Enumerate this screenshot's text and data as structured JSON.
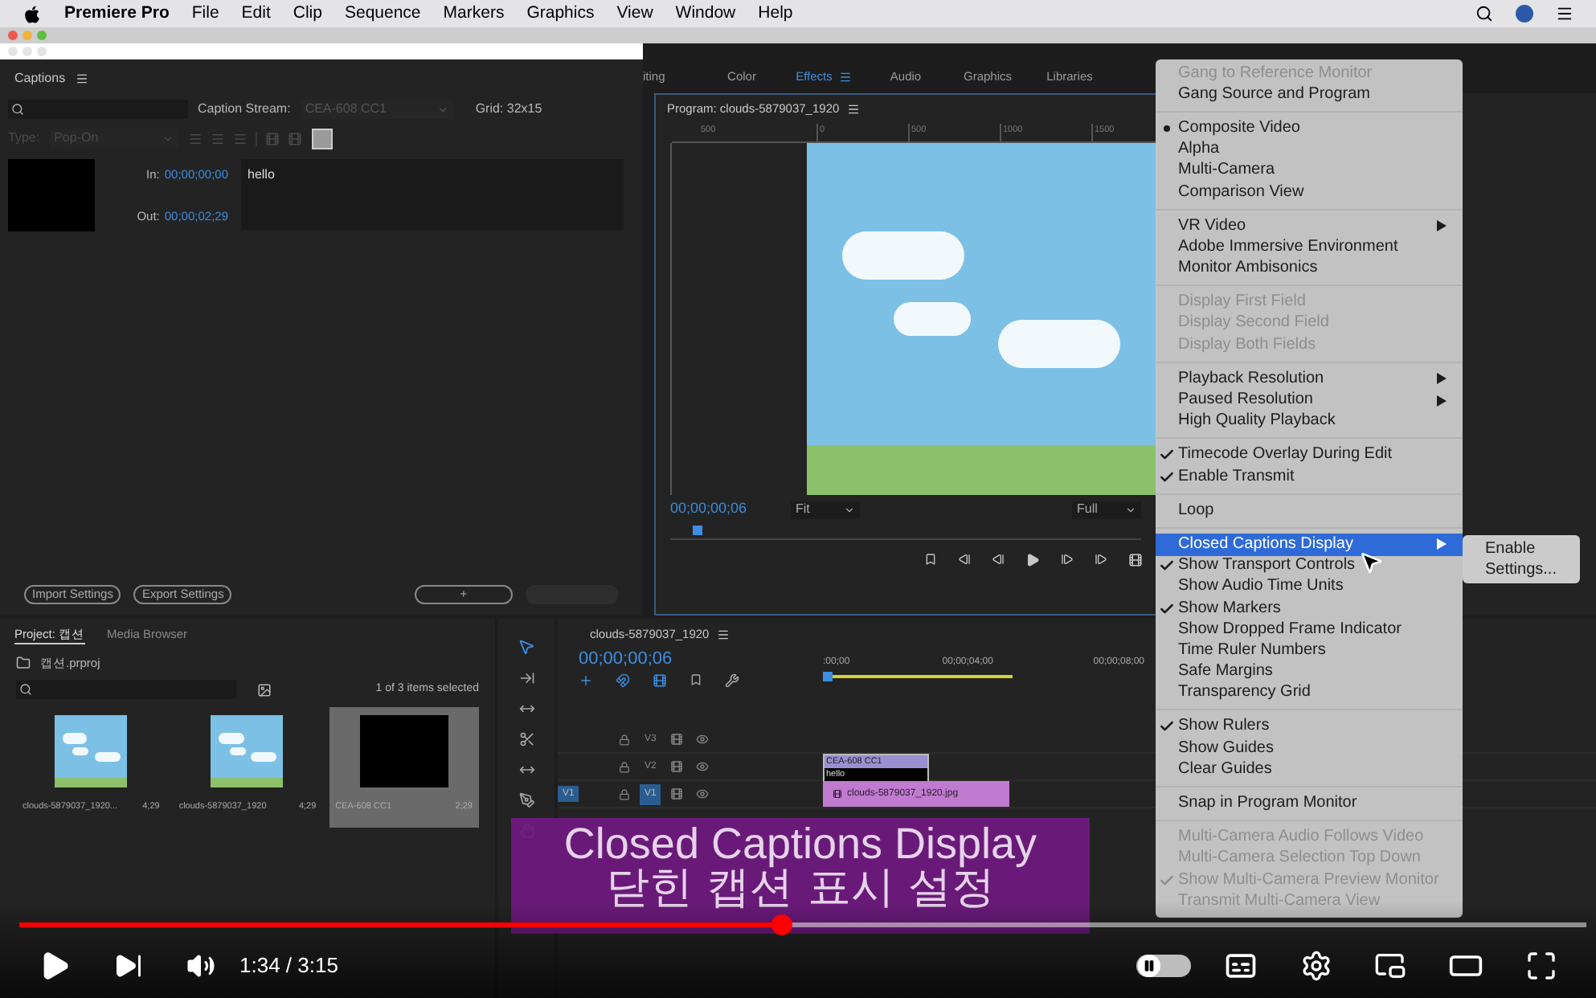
{
  "menubar": {
    "app_name": "Premiere Pro",
    "menus": [
      "File",
      "Edit",
      "Clip",
      "Sequence",
      "Markers",
      "Graphics",
      "View",
      "Window",
      "Help"
    ]
  },
  "workspace_tabs": [
    {
      "label": "iting",
      "selected": false
    },
    {
      "label": "Color",
      "selected": false
    },
    {
      "label": "Effects",
      "selected": true
    },
    {
      "label": "Audio",
      "selected": false
    },
    {
      "label": "Graphics",
      "selected": false
    },
    {
      "label": "Libraries",
      "selected": false
    }
  ],
  "captions_panel": {
    "title": "Captions",
    "caption_stream_label": "Caption Stream:",
    "caption_stream_value": "CEA-608 CC1",
    "grid": "Grid: 32x15",
    "type_label": "Type:",
    "type_value": "Pop-On",
    "in_label": "In:",
    "in_time": "00;00;00;00",
    "out_label": "Out:",
    "out_time": "00;00;02;29",
    "caption_text": "hello",
    "buttons": [
      "Import Settings",
      "Export Settings"
    ],
    "add_button": "+"
  },
  "program_monitor": {
    "title": "Program: clouds-5879037_1920",
    "ruler_labels": [
      "500",
      "0",
      "500",
      "1000",
      "1500"
    ],
    "timecode": "00;00;00;06",
    "zoom": "Fit",
    "resolution": "Full"
  },
  "project_panel": {
    "tabs": [
      {
        "label": "Project: 캡션",
        "selected": true
      },
      {
        "label": "Media Browser",
        "selected": false
      }
    ],
    "project_file": "캡션.prproj",
    "selection_info": "1 of 3 items selected",
    "items": [
      {
        "name": "clouds-5879037_1920...",
        "duration": "4;29",
        "kind": "image",
        "selected": false
      },
      {
        "name": "clouds-5879037_1920",
        "duration": "4;29",
        "kind": "image",
        "selected": false
      },
      {
        "name": "CEA-608 CC1",
        "duration": "2;29",
        "kind": "caption",
        "selected": true
      }
    ]
  },
  "timeline": {
    "title": "clouds-5879037_1920",
    "timecode": "00;00;00;06",
    "ruler_labels": [
      ":00;00",
      "00;00;04;00",
      "00;00;08;00"
    ],
    "source_patch": "V1",
    "tracks": [
      {
        "name": "V3",
        "targeted": false
      },
      {
        "name": "V2",
        "targeted": false
      },
      {
        "name": "V1",
        "targeted": true
      }
    ],
    "caption_clip": {
      "title": "CEA-608 CC1",
      "text": "hello"
    },
    "video_clip": "clouds-5879037_1920.jpg"
  },
  "context_menu": {
    "groups": [
      [
        {
          "label": "Gang to Reference Monitor",
          "kind": "command",
          "checked": false,
          "disabled": true,
          "submenu": false,
          "selected": false
        },
        {
          "label": "Gang Source and Program",
          "kind": "command",
          "checked": false,
          "disabled": false,
          "submenu": false,
          "selected": false
        }
      ],
      [
        {
          "label": "Composite Video",
          "kind": "radio",
          "checked": true,
          "disabled": false,
          "submenu": false,
          "selected": false
        },
        {
          "label": "Alpha",
          "kind": "radio",
          "checked": false,
          "disabled": false,
          "submenu": false,
          "selected": false
        },
        {
          "label": "Multi-Camera",
          "kind": "radio",
          "checked": false,
          "disabled": false,
          "submenu": false,
          "selected": false
        },
        {
          "label": "Comparison View",
          "kind": "radio",
          "checked": false,
          "disabled": false,
          "submenu": false,
          "selected": false
        }
      ],
      [
        {
          "label": "VR Video",
          "kind": "command",
          "checked": false,
          "disabled": false,
          "submenu": true,
          "selected": false
        },
        {
          "label": "Adobe Immersive Environment",
          "kind": "command",
          "checked": false,
          "disabled": false,
          "submenu": false,
          "selected": false
        },
        {
          "label": "Monitor Ambisonics",
          "kind": "command",
          "checked": false,
          "disabled": false,
          "submenu": false,
          "selected": false
        }
      ],
      [
        {
          "label": "Display First Field",
          "kind": "command",
          "checked": false,
          "disabled": true,
          "submenu": false,
          "selected": false
        },
        {
          "label": "Display Second Field",
          "kind": "command",
          "checked": false,
          "disabled": true,
          "submenu": false,
          "selected": false
        },
        {
          "label": "Display Both Fields",
          "kind": "command",
          "checked": false,
          "disabled": true,
          "submenu": false,
          "selected": false
        }
      ],
      [
        {
          "label": "Playback Resolution",
          "kind": "command",
          "checked": false,
          "disabled": false,
          "submenu": true,
          "selected": false
        },
        {
          "label": "Paused Resolution",
          "kind": "command",
          "checked": false,
          "disabled": false,
          "submenu": true,
          "selected": false
        },
        {
          "label": "High Quality Playback",
          "kind": "command",
          "checked": false,
          "disabled": false,
          "submenu": false,
          "selected": false
        }
      ],
      [
        {
          "label": "Timecode Overlay During Edit",
          "kind": "command",
          "checked": true,
          "disabled": false,
          "submenu": false,
          "selected": false
        },
        {
          "label": "Enable Transmit",
          "kind": "command",
          "checked": true,
          "disabled": false,
          "submenu": false,
          "selected": false
        }
      ],
      [
        {
          "label": "Loop",
          "kind": "command",
          "checked": false,
          "disabled": false,
          "submenu": false,
          "selected": false
        }
      ],
      [
        {
          "label": "Closed Captions Display",
          "kind": "command",
          "checked": false,
          "disabled": false,
          "submenu": true,
          "selected": true
        },
        {
          "label": "Show Transport Controls",
          "kind": "command",
          "checked": true,
          "disabled": false,
          "submenu": false,
          "selected": false
        },
        {
          "label": "Show Audio Time Units",
          "kind": "command",
          "checked": false,
          "disabled": false,
          "submenu": false,
          "selected": false
        },
        {
          "label": "Show Markers",
          "kind": "command",
          "checked": true,
          "disabled": false,
          "submenu": false,
          "selected": false
        },
        {
          "label": "Show Dropped Frame Indicator",
          "kind": "command",
          "checked": false,
          "disabled": false,
          "submenu": false,
          "selected": false
        },
        {
          "label": "Time Ruler Numbers",
          "kind": "command",
          "checked": false,
          "disabled": false,
          "submenu": false,
          "selected": false
        },
        {
          "label": "Safe Margins",
          "kind": "command",
          "checked": false,
          "disabled": false,
          "submenu": false,
          "selected": false
        },
        {
          "label": "Transparency Grid",
          "kind": "command",
          "checked": false,
          "disabled": false,
          "submenu": false,
          "selected": false
        }
      ],
      [
        {
          "label": "Show Rulers",
          "kind": "command",
          "checked": true,
          "disabled": false,
          "submenu": false,
          "selected": false
        },
        {
          "label": "Show Guides",
          "kind": "command",
          "checked": false,
          "disabled": false,
          "submenu": false,
          "selected": false
        },
        {
          "label": "Clear Guides",
          "kind": "command",
          "checked": false,
          "disabled": false,
          "submenu": false,
          "selected": false
        }
      ],
      [
        {
          "label": "Snap in Program Monitor",
          "kind": "command",
          "checked": false,
          "disabled": false,
          "submenu": false,
          "selected": false
        }
      ],
      [
        {
          "label": "Multi-Camera Audio Follows Video",
          "kind": "command",
          "checked": false,
          "disabled": true,
          "submenu": false,
          "selected": false
        },
        {
          "label": "Multi-Camera Selection Top Down",
          "kind": "command",
          "checked": false,
          "disabled": true,
          "submenu": false,
          "selected": false
        },
        {
          "label": "Show Multi-Camera Preview Monitor",
          "kind": "command",
          "checked": true,
          "disabled": true,
          "submenu": false,
          "selected": false
        },
        {
          "label": "Transmit Multi-Camera View",
          "kind": "command",
          "checked": false,
          "disabled": true,
          "submenu": false,
          "selected": false
        }
      ]
    ]
  },
  "submenu": [
    "Enable",
    "Settings..."
  ],
  "caption_overlay": {
    "lines": [
      "Closed Captions Display",
      "닫힌 캡션 표시 설정"
    ]
  },
  "player": {
    "progress": {
      "level": 0.486
    },
    "time": "1:34 / 3:15",
    "autoplay_on": false
  }
}
